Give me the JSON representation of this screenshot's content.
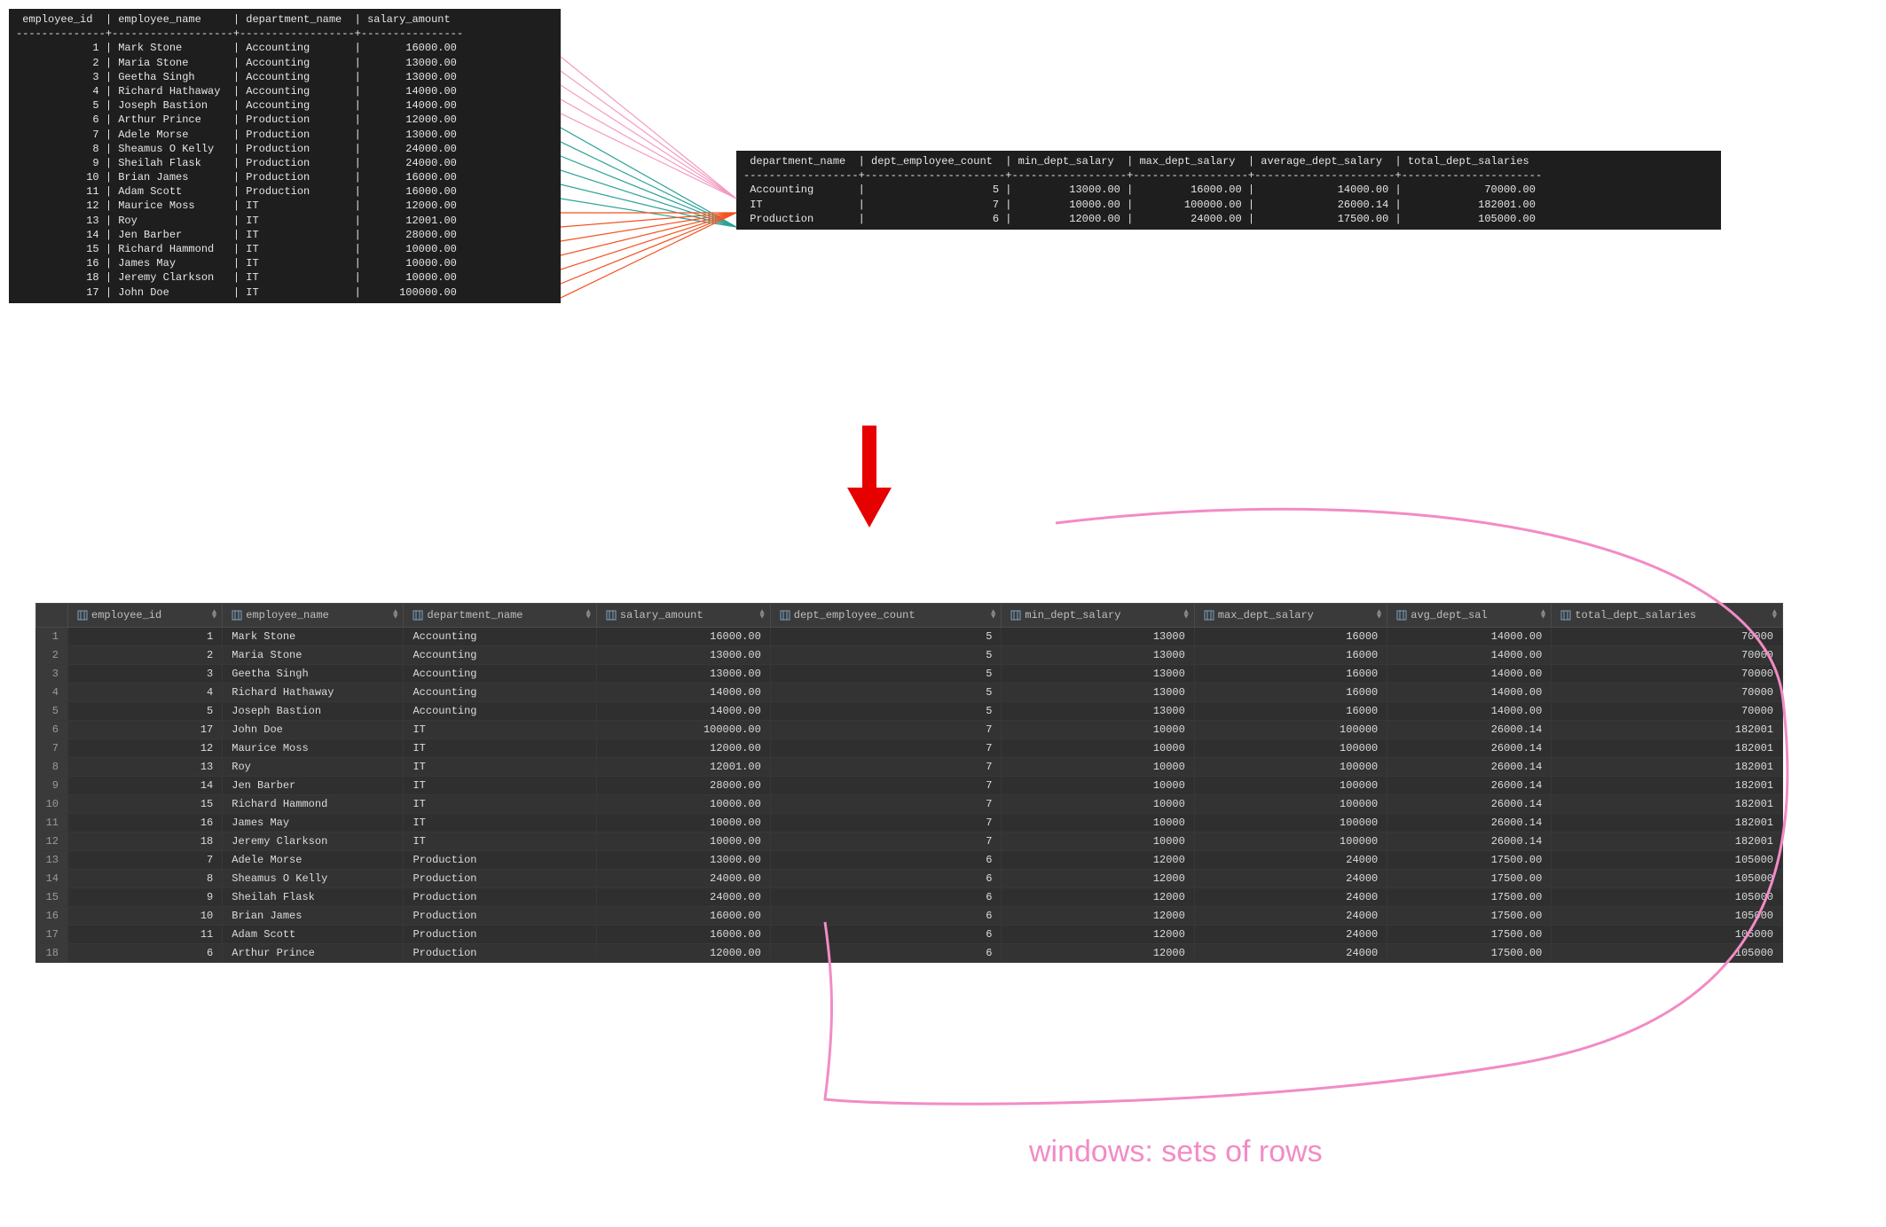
{
  "source_table": {
    "headers": [
      "employee_id",
      "employee_name",
      "department_name",
      "salary_amount"
    ],
    "rows": [
      {
        "id": "1",
        "name": "Mark Stone",
        "dept": "Accounting",
        "salary": "16000.00"
      },
      {
        "id": "2",
        "name": "Maria Stone",
        "dept": "Accounting",
        "salary": "13000.00"
      },
      {
        "id": "3",
        "name": "Geetha Singh",
        "dept": "Accounting",
        "salary": "13000.00"
      },
      {
        "id": "4",
        "name": "Richard Hathaway",
        "dept": "Accounting",
        "salary": "14000.00"
      },
      {
        "id": "5",
        "name": "Joseph Bastion",
        "dept": "Accounting",
        "salary": "14000.00"
      },
      {
        "id": "6",
        "name": "Arthur Prince",
        "dept": "Production",
        "salary": "12000.00"
      },
      {
        "id": "7",
        "name": "Adele Morse",
        "dept": "Production",
        "salary": "13000.00"
      },
      {
        "id": "8",
        "name": "Sheamus O Kelly",
        "dept": "Production",
        "salary": "24000.00"
      },
      {
        "id": "9",
        "name": "Sheilah Flask",
        "dept": "Production",
        "salary": "24000.00"
      },
      {
        "id": "10",
        "name": "Brian James",
        "dept": "Production",
        "salary": "16000.00"
      },
      {
        "id": "11",
        "name": "Adam Scott",
        "dept": "Production",
        "salary": "16000.00"
      },
      {
        "id": "12",
        "name": "Maurice Moss",
        "dept": "IT",
        "salary": "12000.00"
      },
      {
        "id": "13",
        "name": "Roy",
        "dept": "IT",
        "salary": "12001.00"
      },
      {
        "id": "14",
        "name": "Jen Barber",
        "dept": "IT",
        "salary": "28000.00"
      },
      {
        "id": "15",
        "name": "Richard Hammond",
        "dept": "IT",
        "salary": "10000.00"
      },
      {
        "id": "16",
        "name": "James May",
        "dept": "IT",
        "salary": "10000.00"
      },
      {
        "id": "18",
        "name": "Jeremy Clarkson",
        "dept": "IT",
        "salary": "10000.00"
      },
      {
        "id": "17",
        "name": "John Doe",
        "dept": "IT",
        "salary": "100000.00"
      }
    ]
  },
  "agg_table": {
    "headers": [
      "department_name",
      "dept_employee_count",
      "min_dept_salary",
      "max_dept_salary",
      "average_dept_salary",
      "total_dept_salaries"
    ],
    "rows": [
      {
        "dept": "Accounting",
        "cnt": "5",
        "min": "13000.00",
        "max": "16000.00",
        "avg": "14000.00",
        "total": "70000.00"
      },
      {
        "dept": "IT",
        "cnt": "7",
        "min": "10000.00",
        "max": "100000.00",
        "avg": "26000.14",
        "total": "182001.00"
      },
      {
        "dept": "Production",
        "cnt": "6",
        "min": "12000.00",
        "max": "24000.00",
        "avg": "17500.00",
        "total": "105000.00"
      }
    ]
  },
  "result_table": {
    "headers": [
      "employee_id",
      "employee_name",
      "department_name",
      "salary_amount",
      "dept_employee_count",
      "min_dept_salary",
      "max_dept_salary",
      "avg_dept_sal",
      "total_dept_salaries"
    ],
    "rows": [
      {
        "n": "1",
        "id": "1",
        "name": "Mark Stone",
        "dept": "Accounting",
        "salary": "16000.00",
        "cnt": "5",
        "min": "13000",
        "max": "16000",
        "avg": "14000.00",
        "total": "70000"
      },
      {
        "n": "2",
        "id": "2",
        "name": "Maria Stone",
        "dept": "Accounting",
        "salary": "13000.00",
        "cnt": "5",
        "min": "13000",
        "max": "16000",
        "avg": "14000.00",
        "total": "70000"
      },
      {
        "n": "3",
        "id": "3",
        "name": "Geetha Singh",
        "dept": "Accounting",
        "salary": "13000.00",
        "cnt": "5",
        "min": "13000",
        "max": "16000",
        "avg": "14000.00",
        "total": "70000"
      },
      {
        "n": "4",
        "id": "4",
        "name": "Richard Hathaway",
        "dept": "Accounting",
        "salary": "14000.00",
        "cnt": "5",
        "min": "13000",
        "max": "16000",
        "avg": "14000.00",
        "total": "70000"
      },
      {
        "n": "5",
        "id": "5",
        "name": "Joseph Bastion",
        "dept": "Accounting",
        "salary": "14000.00",
        "cnt": "5",
        "min": "13000",
        "max": "16000",
        "avg": "14000.00",
        "total": "70000"
      },
      {
        "n": "6",
        "id": "17",
        "name": "John Doe",
        "dept": "IT",
        "salary": "100000.00",
        "cnt": "7",
        "min": "10000",
        "max": "100000",
        "avg": "26000.14",
        "total": "182001"
      },
      {
        "n": "7",
        "id": "12",
        "name": "Maurice Moss",
        "dept": "IT",
        "salary": "12000.00",
        "cnt": "7",
        "min": "10000",
        "max": "100000",
        "avg": "26000.14",
        "total": "182001"
      },
      {
        "n": "8",
        "id": "13",
        "name": "Roy",
        "dept": "IT",
        "salary": "12001.00",
        "cnt": "7",
        "min": "10000",
        "max": "100000",
        "avg": "26000.14",
        "total": "182001"
      },
      {
        "n": "9",
        "id": "14",
        "name": "Jen Barber",
        "dept": "IT",
        "salary": "28000.00",
        "cnt": "7",
        "min": "10000",
        "max": "100000",
        "avg": "26000.14",
        "total": "182001"
      },
      {
        "n": "10",
        "id": "15",
        "name": "Richard Hammond",
        "dept": "IT",
        "salary": "10000.00",
        "cnt": "7",
        "min": "10000",
        "max": "100000",
        "avg": "26000.14",
        "total": "182001"
      },
      {
        "n": "11",
        "id": "16",
        "name": "James May",
        "dept": "IT",
        "salary": "10000.00",
        "cnt": "7",
        "min": "10000",
        "max": "100000",
        "avg": "26000.14",
        "total": "182001"
      },
      {
        "n": "12",
        "id": "18",
        "name": "Jeremy Clarkson",
        "dept": "IT",
        "salary": "10000.00",
        "cnt": "7",
        "min": "10000",
        "max": "100000",
        "avg": "26000.14",
        "total": "182001"
      },
      {
        "n": "13",
        "id": "7",
        "name": "Adele Morse",
        "dept": "Production",
        "salary": "13000.00",
        "cnt": "6",
        "min": "12000",
        "max": "24000",
        "avg": "17500.00",
        "total": "105000"
      },
      {
        "n": "14",
        "id": "8",
        "name": "Sheamus O Kelly",
        "dept": "Production",
        "salary": "24000.00",
        "cnt": "6",
        "min": "12000",
        "max": "24000",
        "avg": "17500.00",
        "total": "105000"
      },
      {
        "n": "15",
        "id": "9",
        "name": "Sheilah Flask",
        "dept": "Production",
        "salary": "24000.00",
        "cnt": "6",
        "min": "12000",
        "max": "24000",
        "avg": "17500.00",
        "total": "105000"
      },
      {
        "n": "16",
        "id": "10",
        "name": "Brian James",
        "dept": "Production",
        "salary": "16000.00",
        "cnt": "6",
        "min": "12000",
        "max": "24000",
        "avg": "17500.00",
        "total": "105000"
      },
      {
        "n": "17",
        "id": "11",
        "name": "Adam Scott",
        "dept": "Production",
        "salary": "16000.00",
        "cnt": "6",
        "min": "12000",
        "max": "24000",
        "avg": "17500.00",
        "total": "105000"
      },
      {
        "n": "18",
        "id": "6",
        "name": "Arthur Prince",
        "dept": "Production",
        "salary": "12000.00",
        "cnt": "6",
        "min": "12000",
        "max": "24000",
        "avg": "17500.00",
        "total": "105000"
      }
    ]
  },
  "annotation": {
    "caption": "windows: sets of rows"
  },
  "colors": {
    "pink": "#f28bc5",
    "teal": "#2aa198",
    "orange": "#f4511e",
    "red_arrow": "#e60000",
    "terminal_bg": "#1e1e1e",
    "gui_bg": "#2b2b2b"
  },
  "chart_data": {
    "type": "table",
    "note": "Diagram illustrating SQL window functions: the left source employee table is grouped into the right aggregate-by-department table (colored fan lines), then the bottom result table shows the join of source rows with per-department window aggregates. Pink circle highlights the windowed aggregate columns."
  }
}
